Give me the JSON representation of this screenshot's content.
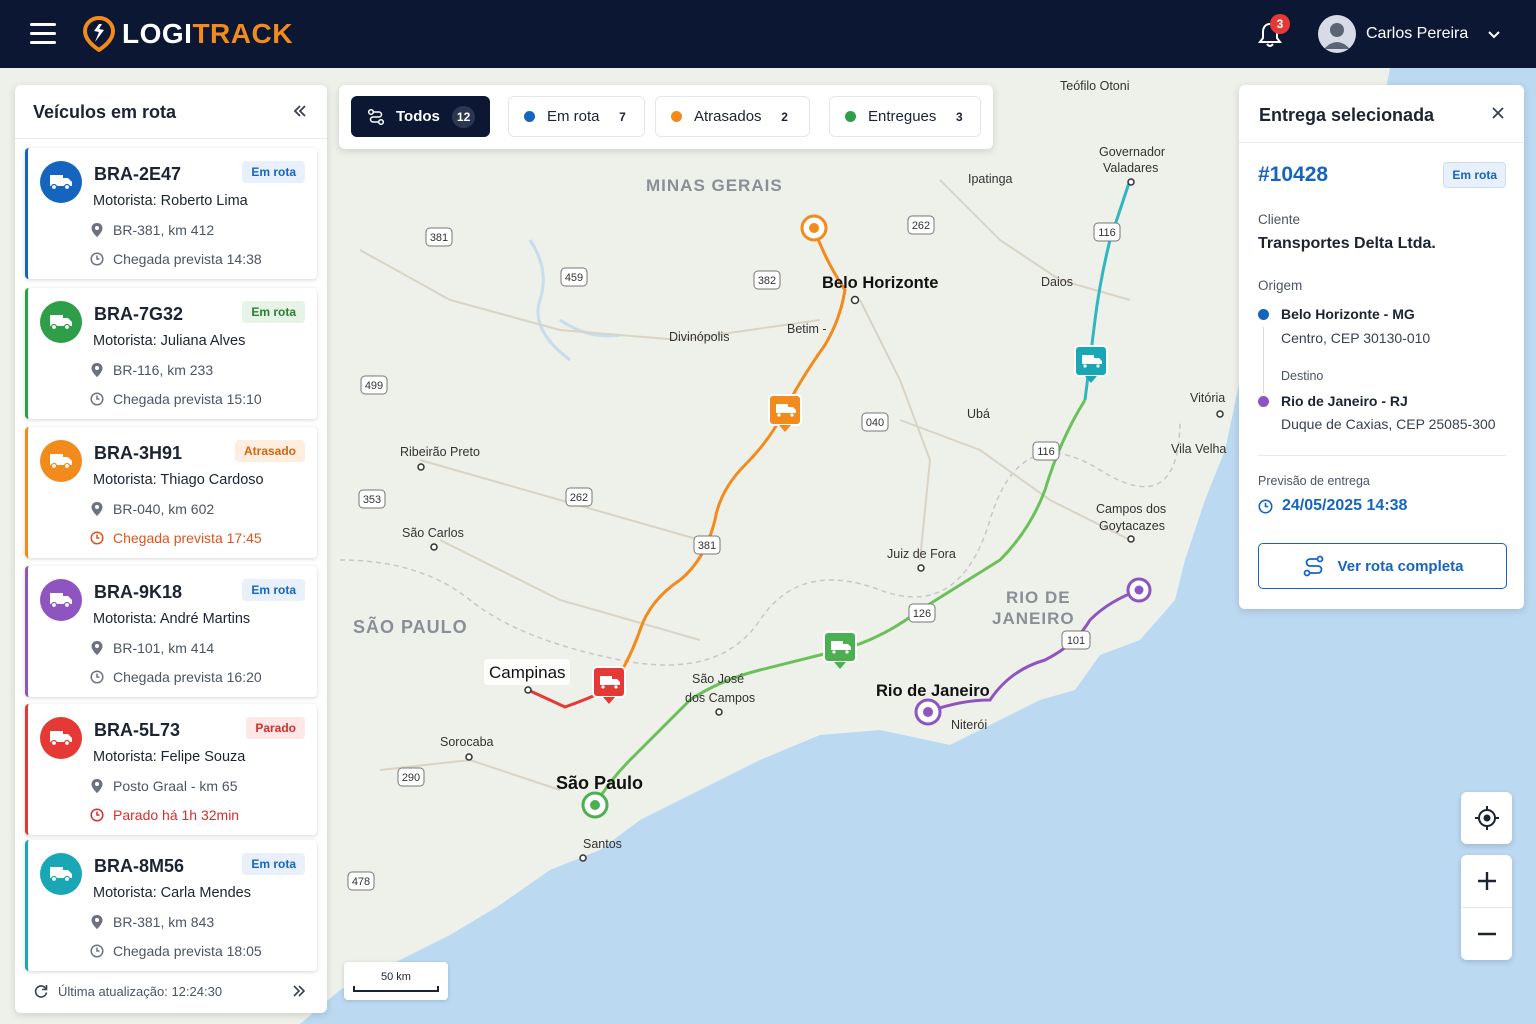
{
  "app": {
    "brand_left": "LOGI",
    "brand_right": "TRACK",
    "brand_accent": "#f28a1c",
    "header_bg": "#0b1733",
    "notifications_count": "3",
    "user_name": "Carlos Pereira"
  },
  "sidebar": {
    "title": "Veículos em rota",
    "vehicles": [
      {
        "plate": "BRA-2E47",
        "status": "Em rota",
        "driver": "Motorista: Roberto Lima",
        "location": "BR-381, km 412",
        "eta": "Chegada prevista 14:38",
        "color": "#1565c0"
      },
      {
        "plate": "BRA-7G32",
        "status": "Em rota",
        "driver": "Motorista: Juliana Alves",
        "location": "BR-116, km 233",
        "eta": "Chegada prevista 15:10",
        "color": "#2e9e48"
      },
      {
        "plate": "BRA-3H91",
        "status": "Atrasado",
        "driver": "Motorista: Thiago Cardoso",
        "location": "BR-040, km 602",
        "eta": "Chegada prevista 17:45",
        "color": "#f28a1c"
      },
      {
        "plate": "BRA-9K18",
        "status": "Em rota",
        "driver": "Motorista: André Martins",
        "location": "BR-101, km 414",
        "eta": "Chegada prevista 16:20",
        "color": "#8e55c0"
      },
      {
        "plate": "BRA-5L73",
        "status": "Parado",
        "driver": "Motorista: Felipe Souza",
        "location": "Posto Graal - km 65",
        "eta": "Parado há 1h 32min",
        "color": "#e53935"
      },
      {
        "plate": "BRA-8M56",
        "status": "Em rota",
        "driver": "Motorista: Carla Mendes",
        "location": "BR-381, km 843",
        "eta": "Chegada prevista 18:05",
        "color": "#1aa7b5"
      }
    ],
    "last_update": "Última atualização: 12:24:30"
  },
  "filters": {
    "all": {
      "label": "Todos",
      "count": "12"
    },
    "en_route": {
      "label": "Em rota",
      "count": "7",
      "color": "#1565c0"
    },
    "delayed": {
      "label": "Atrasados",
      "count": "2",
      "color": "#f28a1c"
    },
    "delivered": {
      "label": "Entregues",
      "count": "3",
      "color": "#2e9e48"
    }
  },
  "delivery": {
    "title": "Entrega selecionada",
    "order": "#10428",
    "status": "Em rota",
    "client_label": "Cliente",
    "client": "Transportes Delta Ltda.",
    "origin_label": "Origem",
    "origin_title": "Belo Horizonte - MG",
    "origin_addr": "Centro, CEP 30130-010",
    "dest_label": "Destino",
    "dest_title": "Rio de Janeiro - RJ",
    "dest_addr": "Duque de Caxias, CEP 25085-300",
    "eta_label": "Previsão de entrega",
    "eta": "24/05/2025 14:38",
    "route_button": "Ver rota completa"
  },
  "map": {
    "scale": "50 km",
    "states": [
      "MINAS GERAIS",
      "SÃO PAULO",
      "RIO DE",
      "JANEIRO"
    ],
    "major_cities": [
      "Belo Horizonte",
      "Campinas",
      "São Paulo",
      "Rio de Janeiro"
    ],
    "cities": [
      "Teófilo Otoni",
      "Governador",
      "Valadares",
      "Ipatinga",
      "Daios",
      "Divinópolis",
      "Betim -",
      "Ubá",
      "Vitória",
      "Vila Velha",
      "Ribeirão Preto",
      "São Carlos",
      "Campos dos",
      "Goytacazes",
      "Juiz de Fora",
      "São José",
      "dos Campos",
      "Sorocaba",
      "Niterói",
      "Santos"
    ],
    "road_shields": [
      "381",
      "459",
      "382",
      "262",
      "116",
      "499",
      "040",
      "116",
      "353",
      "262",
      "381",
      "126",
      "101",
      "290",
      "478"
    ]
  }
}
